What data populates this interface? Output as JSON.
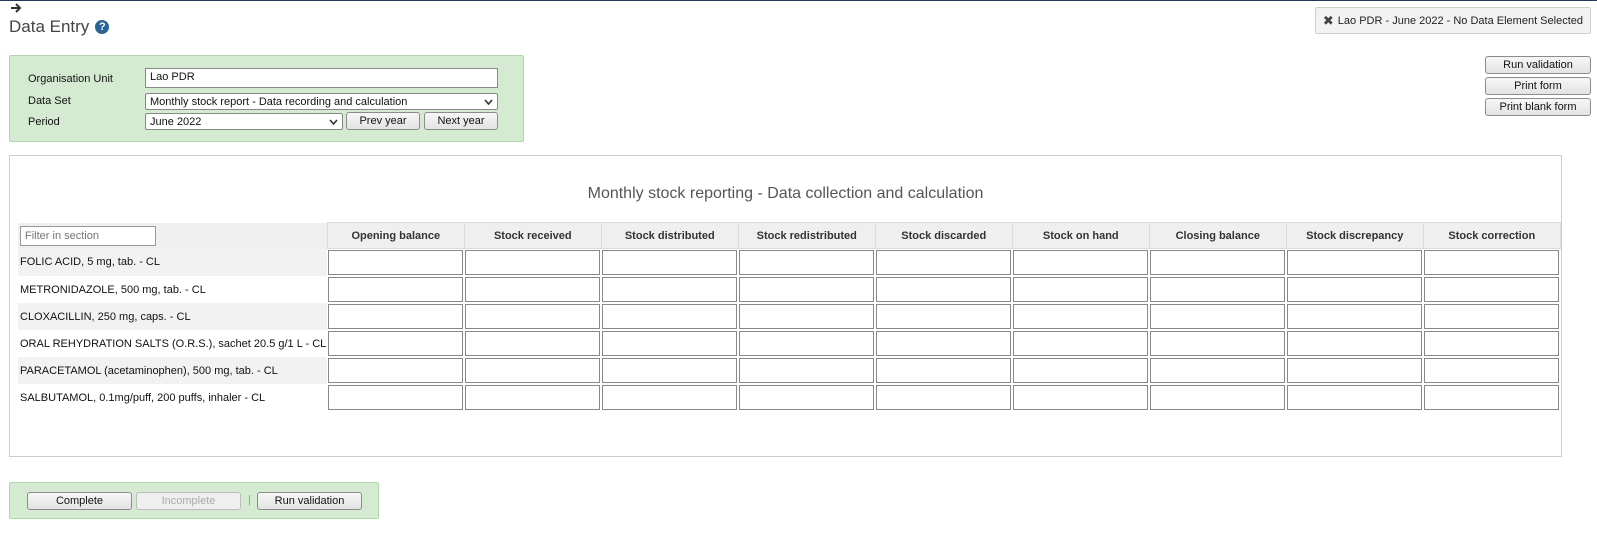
{
  "header": {
    "back_icon": "arrow-right-icon",
    "title": "Data Entry",
    "help_glyph": "?",
    "status_text": "Lao PDR - June 2022 - No Data Element Selected",
    "status_icon_glyph": "✖"
  },
  "actions": {
    "run_validation": "Run validation",
    "print_form": "Print form",
    "print_blank_form": "Print blank form"
  },
  "selection": {
    "org_unit_label": "Organisation Unit",
    "org_unit_value": "Lao PDR",
    "data_set_label": "Data Set",
    "data_set_value": "Monthly stock report - Data recording and calculation",
    "period_label": "Period",
    "period_value": "June 2022",
    "prev_year": "Prev year",
    "next_year": "Next year"
  },
  "form": {
    "title": "Monthly stock reporting - Data collection and calculation",
    "filter_placeholder": "Filter in section",
    "columns": [
      "Opening balance",
      "Stock received",
      "Stock distributed",
      "Stock redistributed",
      "Stock discarded",
      "Stock on hand",
      "Closing balance",
      "Stock discrepancy",
      "Stock correction"
    ],
    "rows": [
      "FOLIC ACID, 5 mg, tab. - CL",
      "METRONIDAZOLE, 500 mg, tab. - CL",
      "CLOXACILLIN, 250 mg, caps. - CL",
      "ORAL REHYDRATION SALTS (O.R.S.), sachet 20.5 g/1 L - CL",
      "PARACETAMOL (acetaminophen), 500 mg, tab. - CL",
      "SALBUTAMOL, 0.1mg/puff, 200 puffs, inhaler - CL"
    ]
  },
  "bottom": {
    "complete": "Complete",
    "incomplete": "Incomplete",
    "separator": "|",
    "run_validation": "Run validation"
  },
  "colors": {
    "panel_green": "#d4ebd1",
    "help_blue": "#2a6496"
  }
}
